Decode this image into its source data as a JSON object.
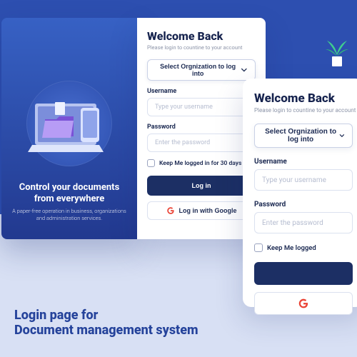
{
  "hero": {
    "headline": "Control your documents from everywhere",
    "tagline": "A paper-free operation in business, organizations and administration services."
  },
  "form": {
    "title": "Welcome Back",
    "subtitle": "Please login to countine to your account",
    "org_select_label": "Select Orgnization to log into",
    "username_label": "Username",
    "username_placeholder": "Type your username",
    "password_label": "Password",
    "password_placeholder": "Enter the password",
    "remember_label_full": "Keep Me logged in for 30 days",
    "remember_label_short": "Keep Me logged",
    "login_button": "Log in",
    "google_button": "Log in with Google"
  },
  "caption": {
    "line1": "Login page for",
    "line2": "Document management system"
  },
  "colors": {
    "brand_primary": "#2d4fb0",
    "brand_dark": "#1c2f64",
    "text_heading": "#16234e",
    "text_muted": "#8c94a8"
  }
}
